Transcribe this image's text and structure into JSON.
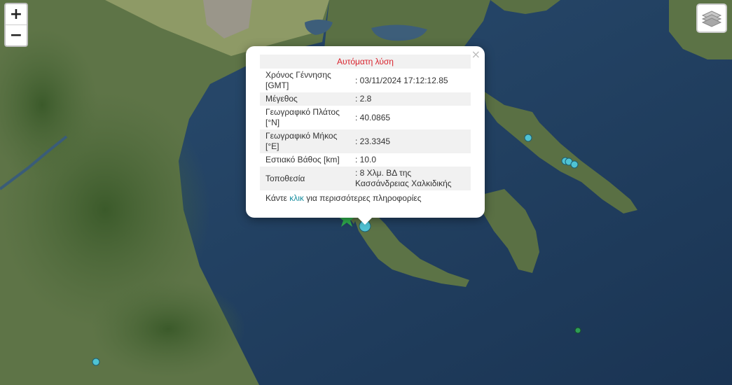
{
  "zoom": {
    "in_label": "+",
    "out_label": "−"
  },
  "popup": {
    "close_label": "×",
    "header": "Αυτόματη λύση",
    "rows": [
      {
        "key": "Χρόνος Γέννησης [GMT]",
        "value": ": 03/11/2024 17:12:12.85"
      },
      {
        "key": "Μέγεθος",
        "value": ": 2.8"
      },
      {
        "key": "Γεωγραφικό Πλάτος [°N]",
        "value": ": 40.0865"
      },
      {
        "key": "Γεωγραφικό Μήκος [°E]",
        "value": ": 23.3345"
      },
      {
        "key": "Εστιακό Βάθος [km]",
        "value": ": 10.0"
      },
      {
        "key": "Τοποθεσία",
        "value": ": 8 Χλμ. ΒΔ της Κασσάνδρειας Χαλκιδικής"
      }
    ],
    "more_prefix": "Κάντε ",
    "more_link": "κλικ",
    "more_suffix": " για περισσότερες πληροφορίες"
  },
  "markers": {
    "epicenter_icon": "star-icon",
    "event_color": "#4fc3d3",
    "recent_color": "#2e9d55",
    "star_color": "#2fae4d"
  }
}
